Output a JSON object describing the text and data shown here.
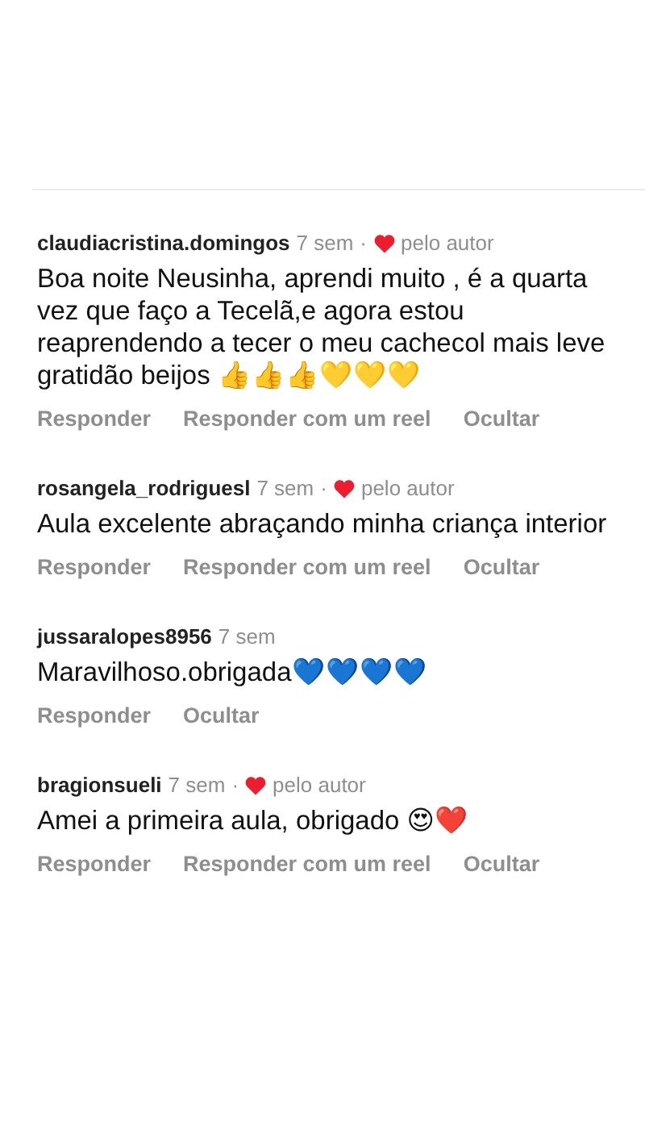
{
  "separator": "·",
  "comments": [
    {
      "username": "claudiacristina.domingos",
      "time": "7 sem",
      "liked_by_author": true,
      "liked_label": "pelo autor",
      "text": "Boa noite Neusinha, aprendi muito , é a quarta vez que faço a Tecelã,e agora estou reaprendendo a tecer o meu cachecol mais leve gratidão beijos 👍👍👍💛💛💛",
      "actions": [
        "Responder",
        "Responder com um reel",
        "Ocultar"
      ]
    },
    {
      "username": "rosangela_rodriguesl",
      "time": "7 sem",
      "liked_by_author": true,
      "liked_label": "pelo autor",
      "text": "Aula excelente abraçando minha criança interior",
      "actions": [
        "Responder",
        "Responder com um reel",
        "Ocultar"
      ]
    },
    {
      "username": "jussaralopes8956",
      "time": "7 sem",
      "liked_by_author": false,
      "text": "Maravilhoso.obrigada💙💙💙💙",
      "actions": [
        "Responder",
        "Ocultar"
      ]
    },
    {
      "username": "bragionsueli",
      "time": "7 sem",
      "liked_by_author": true,
      "liked_label": "pelo autor",
      "text": "Amei a primeira aula, obrigado 😍❤️",
      "actions": [
        "Responder",
        "Responder com um reel",
        "Ocultar"
      ]
    }
  ]
}
